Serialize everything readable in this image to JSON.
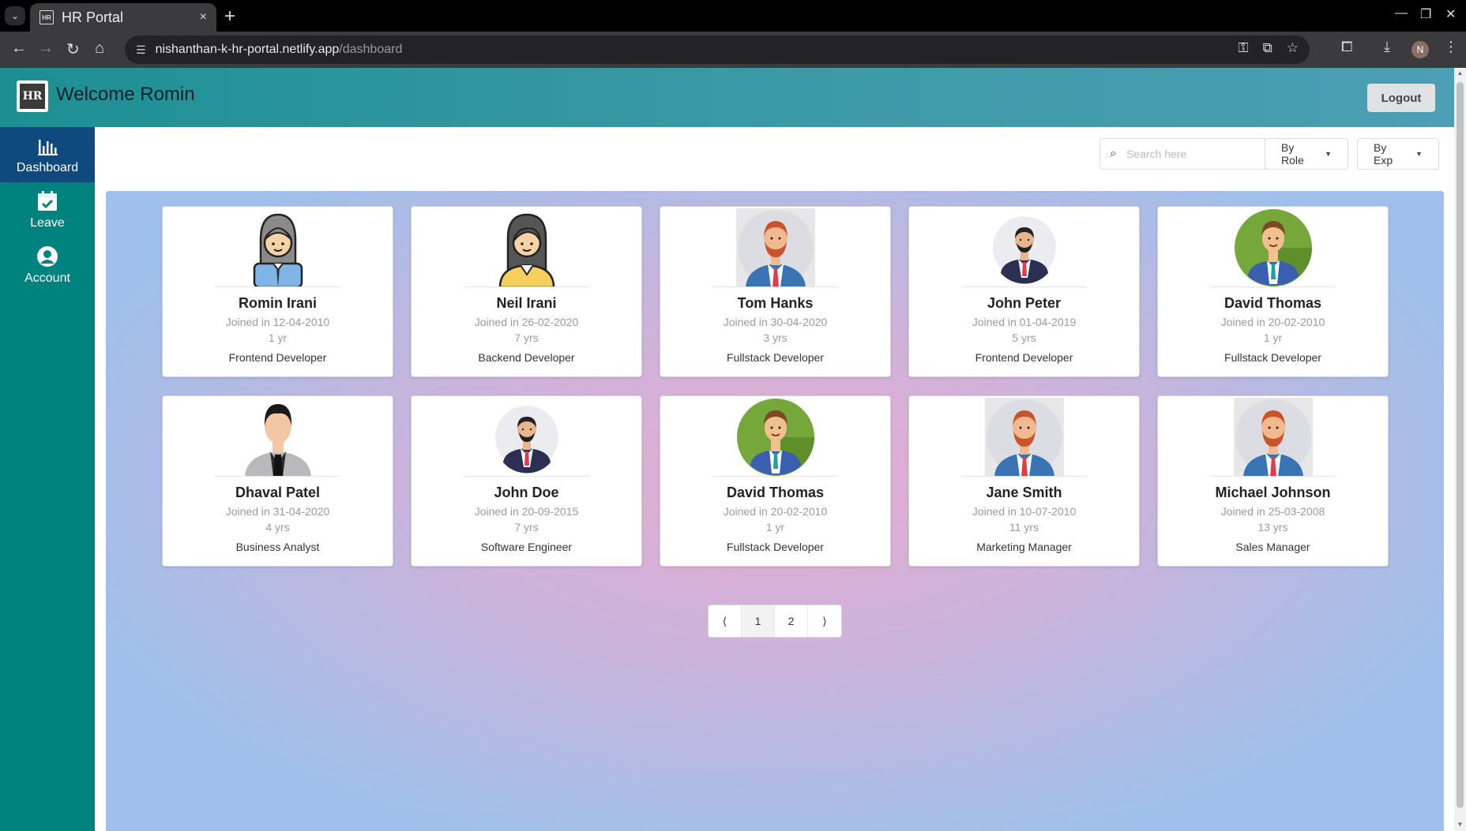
{
  "browser": {
    "tab_title": "HR Portal",
    "tab_favicon": "HR",
    "new_tab": "+",
    "close_tab": "×",
    "url_host": "nishanthan-k-hr-portal.netlify.app",
    "url_path": "/dashboard",
    "profile_initial": "N"
  },
  "header": {
    "logo_text": "HR",
    "welcome": "Welcome Romin",
    "logout_label": "Logout"
  },
  "sidebar": {
    "items": [
      {
        "label": "Dashboard",
        "icon": "bar-chart-icon",
        "active": true
      },
      {
        "label": "Leave",
        "icon": "calendar-check-icon",
        "active": false
      },
      {
        "label": "Account",
        "icon": "user-circle-icon",
        "active": false
      }
    ]
  },
  "filters": {
    "search_placeholder": "Search here",
    "search_value": "",
    "role_label": "By Role",
    "exp_label": "By Exp"
  },
  "employees": [
    {
      "name": "Romin Irani",
      "joined": "Joined in 12-04-2010",
      "exp": "1 yr",
      "role": "Frontend Developer",
      "avatar": "woman-grey-hair-avatar"
    },
    {
      "name": "Neil Irani",
      "joined": "Joined in 26-02-2020",
      "exp": "7 yrs",
      "role": "Backend Developer",
      "avatar": "woman-yellow-shirt-avatar"
    },
    {
      "name": "Tom Hanks",
      "joined": "Joined in 30-04-2020",
      "exp": "3 yrs",
      "role": "Fullstack Developer",
      "avatar": "bearded-man-grey-bg-avatar"
    },
    {
      "name": "John Peter",
      "joined": "Joined in 01-04-2019",
      "exp": "5 yrs",
      "role": "Frontend Developer",
      "avatar": "man-suit-circle-avatar"
    },
    {
      "name": "David Thomas",
      "joined": "Joined in 20-02-2010",
      "exp": "1 yr",
      "role": "Fullstack Developer",
      "avatar": "man-green-circle-avatar"
    },
    {
      "name": "Dhaval Patel",
      "joined": "Joined in 31-04-2020",
      "exp": "4 yrs",
      "role": "Business Analyst",
      "avatar": "man-grey-suit-avatar"
    },
    {
      "name": "John Doe",
      "joined": "Joined in 20-09-2015",
      "exp": "7 yrs",
      "role": "Software Engineer",
      "avatar": "man-suit-circle-avatar"
    },
    {
      "name": "David Thomas",
      "joined": "Joined in 20-02-2010",
      "exp": "1 yr",
      "role": "Fullstack Developer",
      "avatar": "man-green-circle-avatar"
    },
    {
      "name": "Jane Smith",
      "joined": "Joined in 10-07-2010",
      "exp": "11 yrs",
      "role": "Marketing Manager",
      "avatar": "bearded-man-grey-bg-avatar"
    },
    {
      "name": "Michael Johnson",
      "joined": "Joined in 25-03-2008",
      "exp": "13 yrs",
      "role": "Sales Manager",
      "avatar": "bearded-man-grey-bg-avatar"
    }
  ],
  "pagination": {
    "prev": "⟨",
    "pages": [
      "1",
      "2"
    ],
    "current": "1",
    "next": "⟩"
  },
  "colors": {
    "sidebar": "#00827f",
    "sidebar_active": "#0e4a7e",
    "header_start": "#1c8f93",
    "header_end": "#4c9fb4"
  }
}
